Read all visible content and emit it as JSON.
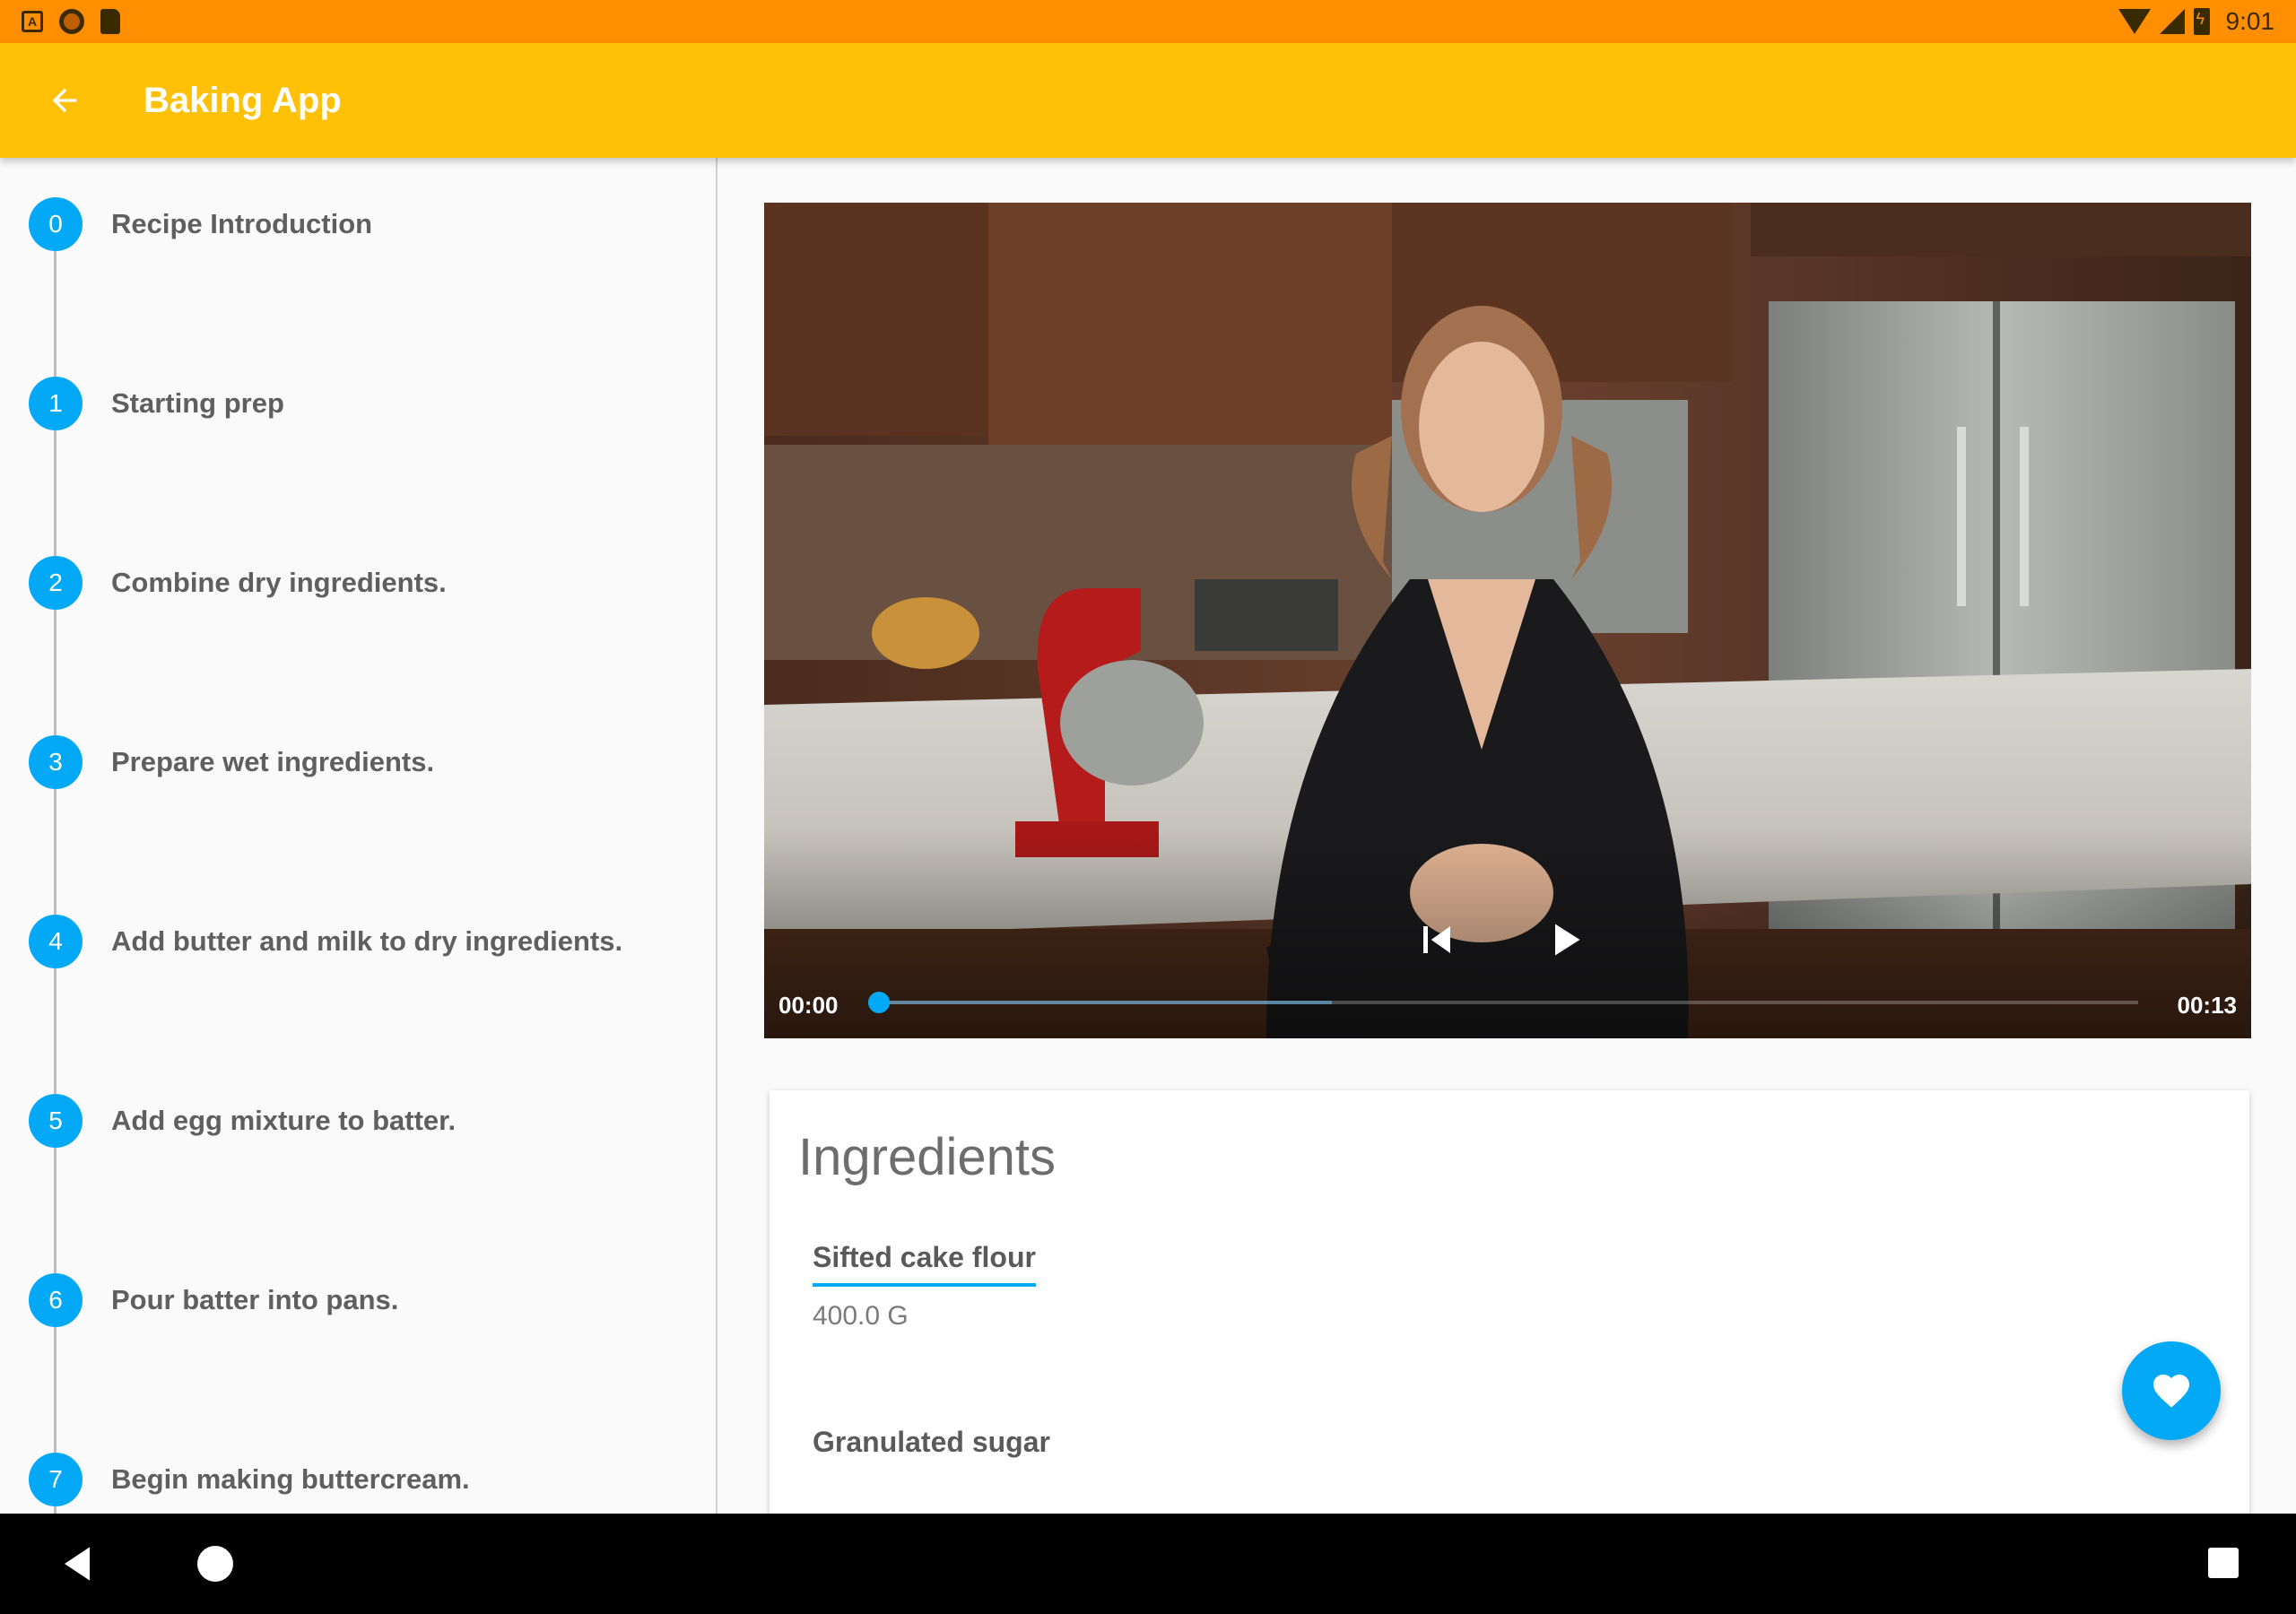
{
  "status_bar": {
    "time": "9:01",
    "icons": [
      "app-notification-icon",
      "record-icon",
      "sd-card-icon",
      "wifi-icon",
      "cell-signal-icon",
      "battery-charging-icon"
    ]
  },
  "app_bar": {
    "title": "Baking App",
    "back_icon": "arrow-back-icon"
  },
  "steps": [
    {
      "number": "0",
      "label": "Recipe Introduction"
    },
    {
      "number": "1",
      "label": "Starting prep"
    },
    {
      "number": "2",
      "label": "Combine dry ingredients."
    },
    {
      "number": "3",
      "label": "Prepare wet ingredients."
    },
    {
      "number": "4",
      "label": "Add butter and milk to dry ingredients."
    },
    {
      "number": "5",
      "label": "Add egg mixture to batter."
    },
    {
      "number": "6",
      "label": "Pour batter into pans."
    },
    {
      "number": "7",
      "label": "Begin making buttercream."
    }
  ],
  "player": {
    "current_time": "00:00",
    "duration": "00:13",
    "progress_fraction": 0.0,
    "buffered_fraction": 0.36
  },
  "ingredients": {
    "title": "Ingredients",
    "items": [
      {
        "name": "Sifted cake flour",
        "quantity": "400.0 G"
      },
      {
        "name": "Granulated sugar",
        "quantity": ""
      }
    ]
  },
  "fab": {
    "icon": "heart-icon"
  },
  "colors": {
    "status_bar": "#ff8f00",
    "app_bar": "#ffc107",
    "accent": "#03a9f4"
  }
}
